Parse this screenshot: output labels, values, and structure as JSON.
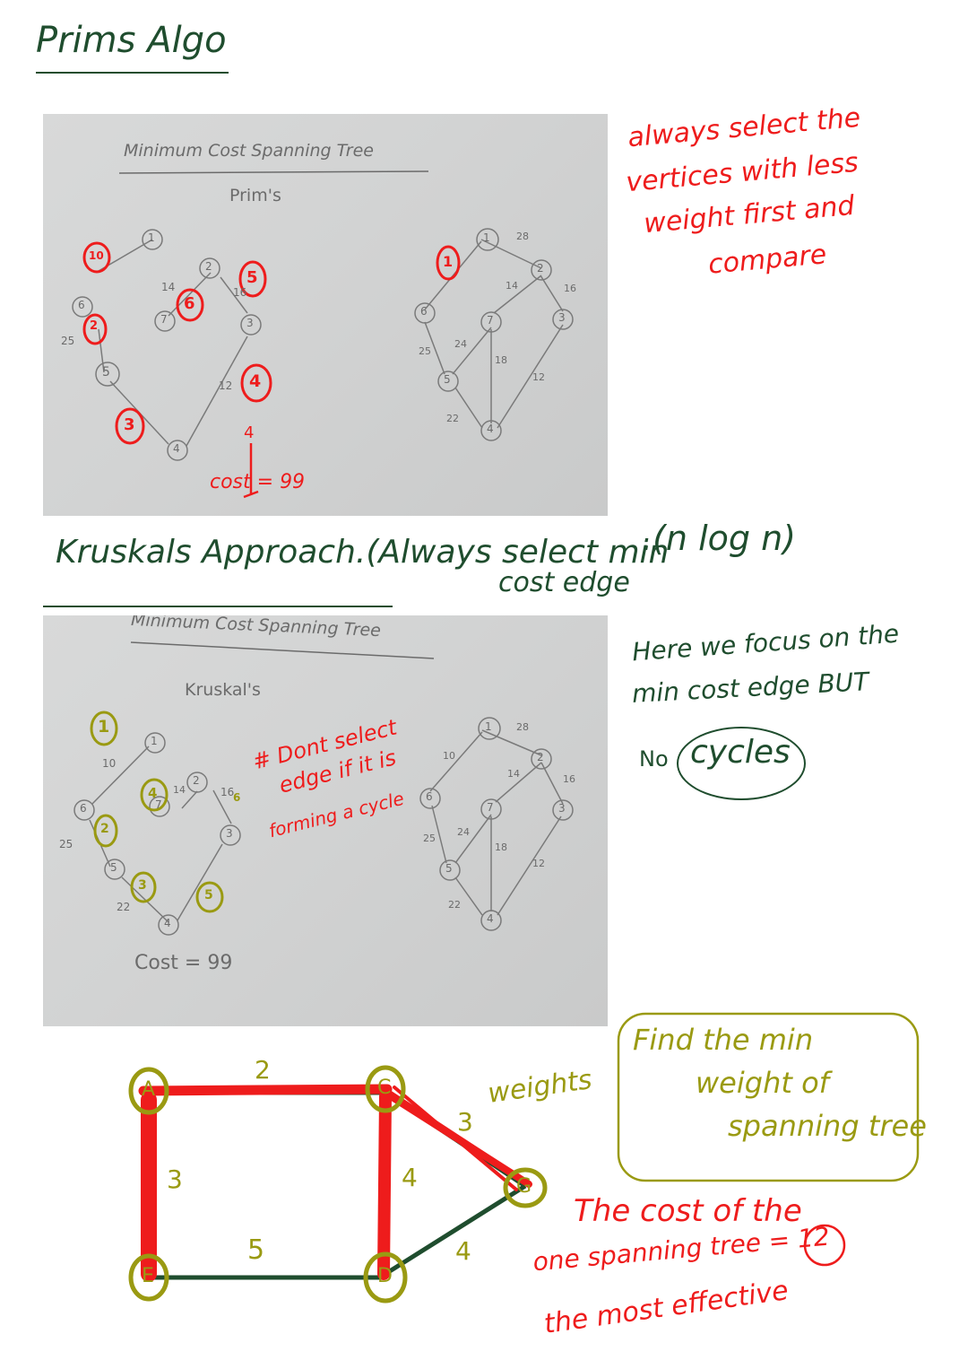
{
  "titles": {
    "prims": "Prims Algo",
    "kruskals": "Kruskals Approach.(Always select min",
    "kruskals_line2": "cost edge",
    "complexity": ".(n log n)"
  },
  "prims_notes": {
    "line1": "always select the",
    "line2": "vertices with less",
    "line3": "weight first and",
    "line4": "compare"
  },
  "prims_photo": {
    "title": "Minimum Cost Spanning Tree",
    "subtitle": "Prim's",
    "cost": "cost = 99",
    "cost_arrow_num": "4",
    "order_marks": [
      "10",
      "6",
      "5",
      "3",
      "4",
      "2",
      "1"
    ],
    "vertices": [
      "1",
      "2",
      "3",
      "4",
      "5",
      "6",
      "7"
    ],
    "left_weights": [
      "14",
      "16",
      "25",
      "12"
    ],
    "right_weights": [
      "28",
      "14",
      "16",
      "25",
      "24",
      "18",
      "12",
      "22"
    ]
  },
  "kruskals_notes": {
    "line1": "Here we focus on the",
    "line2": "min cost edge BUT",
    "line3": "No",
    "line3b": "cycles"
  },
  "kruskals_photo": {
    "title": "Minimum Cost Spanning Tree",
    "subtitle": "Kruskal's",
    "cost": "Cost = 99",
    "cycle_note_1": "# Dont select",
    "cycle_note_2": "edge if it is",
    "cycle_note_3": "forming a cycle",
    "order_marks": [
      "1",
      "4",
      "2",
      "3",
      "5",
      "6"
    ],
    "vertices": [
      "1",
      "2",
      "3",
      "4",
      "5",
      "6",
      "7"
    ],
    "left_weights": [
      "10",
      "14",
      "16",
      "25",
      "22"
    ],
    "right_weights": [
      "10",
      "28",
      "14",
      "16",
      "25",
      "24",
      "18",
      "12",
      "22"
    ]
  },
  "graph": {
    "nodes": [
      "A",
      "C",
      "E",
      "D",
      "G"
    ],
    "weights": {
      "AC": "2",
      "AE": "3",
      "CD": "4",
      "CG": "3",
      "DG": "4",
      "ED": "5"
    },
    "weights_label": "weights",
    "find_box_1": "Find the min",
    "find_box_2": "weight of",
    "find_box_3": "spanning tree",
    "cost_line1": "The cost of the",
    "cost_line2": "one spanning tree = 12",
    "cost_line3": "the most effective",
    "colors": {
      "selected": "#ee1c1c",
      "unselected": "#1f4d2e",
      "node": "#9a9a12"
    }
  }
}
